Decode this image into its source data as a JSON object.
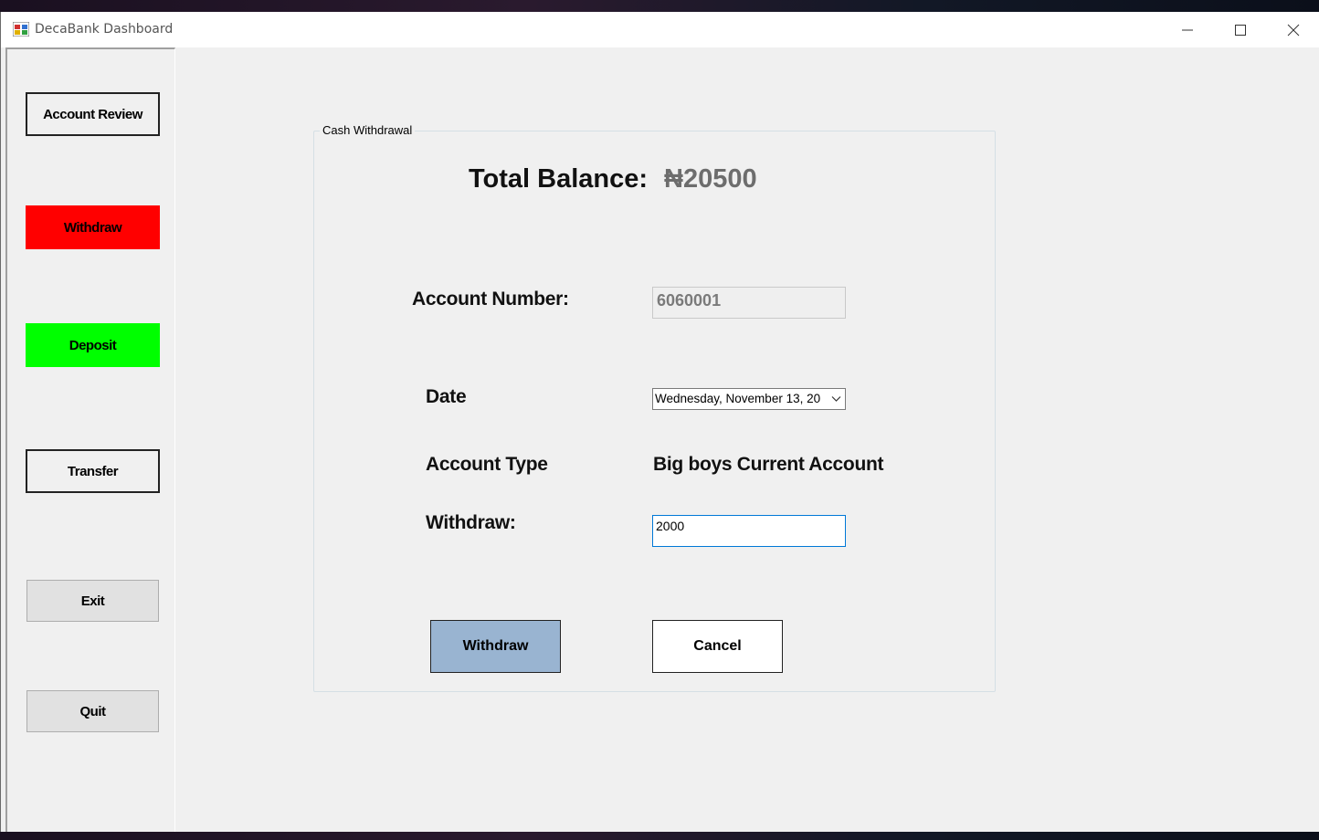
{
  "window": {
    "title": "DecaBank Dashboard"
  },
  "sidebar": {
    "account_review": "Account Review",
    "withdraw": "Withdraw",
    "deposit": "Deposit",
    "transfer": "Transfer",
    "exit": "Exit",
    "quit": "Quit"
  },
  "form": {
    "group_title": "Cash Withdrawal",
    "balance_label": "Total Balance:",
    "balance_value": "₦20500",
    "account_number_label": "Account Number:",
    "account_number_value": "6060001",
    "date_label": "Date",
    "date_value": "Wednesday, November 13, 20",
    "account_type_label": "Account Type",
    "account_type_value": "Big boys Current Account",
    "withdraw_label": "Withdraw:",
    "withdraw_value": "2000",
    "withdraw_button": "Withdraw",
    "cancel_button": "Cancel"
  },
  "colors": {
    "withdraw_nav": "#ff0000",
    "deposit_nav": "#00ff00",
    "withdraw_action": "#99b4d1",
    "focus_border": "#0078d7"
  },
  "icons": [
    "app-icon",
    "minimize-icon",
    "maximize-icon",
    "close-icon",
    "chevron-down-icon"
  ]
}
